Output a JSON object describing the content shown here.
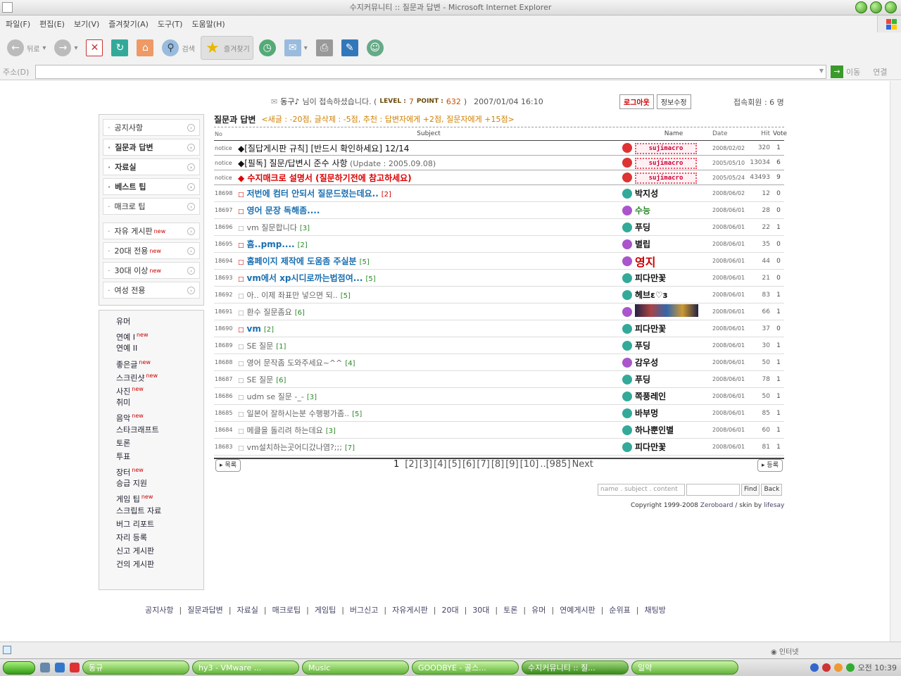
{
  "window": {
    "title": "수지커뮤니티 :: 질문과 답변 - Microsoft Internet Explorer"
  },
  "menu": [
    "파일(F)",
    "편집(E)",
    "보기(V)",
    "즐겨찾기(A)",
    "도구(T)",
    "도움말(H)"
  ],
  "toolbar": {
    "back": "뒤로",
    "search": "검색",
    "favorites": "즐겨찾기"
  },
  "address": {
    "label": "주소(D)",
    "value": "",
    "go": "이동",
    "links": "연결"
  },
  "login": {
    "user": "동구♪",
    "message": "님이 접속하셨습니다. (",
    "level_label": "LEVEL :",
    "level": "7",
    "point_label": "POINT :",
    "point": "632",
    "close": ")",
    "datetime": "2007/01/04 16:10",
    "logout": "로그아웃",
    "edit": "정보수정",
    "members": "접속회원 : 6 명"
  },
  "sidebar1": [
    {
      "label": "공지사항",
      "bold": false,
      "new": false
    },
    {
      "label": "질문과 답변",
      "bold": true,
      "new": false
    },
    {
      "label": "자료실",
      "bold": true,
      "new": false
    },
    {
      "label": "베스트 팁",
      "bold": true,
      "new": false
    },
    {
      "label": "매크로 팁",
      "bold": false,
      "new": false
    },
    {
      "label": "자유 게시판",
      "bold": false,
      "new": true
    },
    {
      "label": "20대 전용",
      "bold": false,
      "new": true
    },
    {
      "label": "30대 이상",
      "bold": false,
      "new": true
    },
    {
      "label": "여성 전용",
      "bold": false,
      "new": false
    }
  ],
  "new_label": "new",
  "sidebar2": [
    {
      "label": "유머",
      "new": false
    },
    {
      "label": "연예 I",
      "new": true
    },
    {
      "label": "연예 II",
      "new": false
    },
    {
      "label": "좋은글",
      "new": true
    },
    {
      "label": "스크린샷",
      "new": true
    },
    {
      "label": "사진",
      "new": true
    },
    {
      "label": "취미",
      "new": false
    },
    {
      "label": "음악",
      "new": true
    },
    {
      "label": "스타크래프트",
      "new": false
    },
    {
      "label": "토론",
      "new": false
    },
    {
      "label": "투표",
      "new": false
    },
    {
      "label": "장터",
      "new": true
    },
    {
      "label": "승급 지원",
      "new": false
    },
    {
      "label": "게임 팁",
      "new": true
    },
    {
      "label": "스크립트 자료",
      "new": false
    },
    {
      "label": "버그 리포트",
      "new": false
    },
    {
      "label": "자리 등록",
      "new": false
    },
    {
      "label": "신고 게시판",
      "new": false
    },
    {
      "label": "건의 게시판",
      "new": false
    }
  ],
  "board": {
    "title": "질문과 답변",
    "subtitle": "<새글 : -20점, 글삭제 : -5점, 추천 : 답변자에게 +2점, 질문자에게 +15점>",
    "headers": {
      "no": "No",
      "subject": "Subject",
      "name": "Name",
      "date": "Date",
      "hit": "Hit",
      "vote": "Vote"
    }
  },
  "notices": [
    {
      "no": "notice",
      "subject": "◆[질답게시판 규칙] [반드시 확인하세요] 12/14",
      "extra": "",
      "color": "#111",
      "bold": false,
      "name": "sujimacro",
      "date": "2008/02/02",
      "hit": "320",
      "vote": "1"
    },
    {
      "no": "notice",
      "subject": "◆[필독] 질문/답변시 준수 사항",
      "extra": " (Update : 2005.09.08)",
      "color": "#111",
      "bold": false,
      "name": "sujimacro",
      "date": "2005/05/10",
      "hit": "13034",
      "vote": "6"
    },
    {
      "no": "notice",
      "subject": "◆ 수지매크로 설명서 (질문하기전에 참고하세요)",
      "extra": "",
      "color": "#d00",
      "bold": true,
      "name": "sujimacro",
      "date": "2005/05/24",
      "hit": "43493",
      "vote": "9"
    }
  ],
  "posts": [
    {
      "no": "18698",
      "subject": "저번에 컴터 안되서 질문드렸는데요..",
      "comments": "[2]",
      "style": "bb",
      "cmred": true,
      "name": "박지성",
      "date": "2008/06/02",
      "hit": "12",
      "vote": "0"
    },
    {
      "no": "18697",
      "subject": "영어 문장 독해좀....",
      "comments": "",
      "style": "bb",
      "cmred": false,
      "name": "수능",
      "date": "2008/06/01",
      "hit": "28",
      "vote": "0"
    },
    {
      "no": "18696",
      "subject": "vm 질문합니다",
      "comments": "[3]",
      "style": "n",
      "cmred": false,
      "name": "푸딩",
      "date": "2008/06/01",
      "hit": "22",
      "vote": "1"
    },
    {
      "no": "18695",
      "subject": "흠..pmp....",
      "comments": "[2]",
      "style": "bb",
      "cmred": false,
      "name": "별립",
      "date": "2008/06/01",
      "hit": "35",
      "vote": "0"
    },
    {
      "no": "18694",
      "subject": "홈페이지 제작에 도움좀 주실분",
      "comments": "[5]",
      "style": "bb",
      "cmred": false,
      "name": "영지",
      "date": "2008/06/01",
      "hit": "44",
      "vote": "0"
    },
    {
      "no": "18693",
      "subject": "vm에서 xp시디로까는법점여...",
      "comments": "[5]",
      "style": "bb",
      "cmred": false,
      "name": "피다만꽃",
      "date": "2008/06/01",
      "hit": "21",
      "vote": "0"
    },
    {
      "no": "18692",
      "subject": "아.. 이제 좌표만 넣으면 되..",
      "comments": "[5]",
      "style": "n",
      "cmred": false,
      "name": "헤브ε♡з",
      "date": "2008/06/01",
      "hit": "83",
      "vote": "1"
    },
    {
      "no": "18691",
      "subject": "환수 질문좀요",
      "comments": "[6]",
      "style": "n",
      "cmred": false,
      "name": "",
      "date": "2008/06/01",
      "hit": "66",
      "vote": "1"
    },
    {
      "no": "18690",
      "subject": "vm",
      "comments": "[2]",
      "style": "bb",
      "cmred": false,
      "name": "피다만꽃",
      "date": "2008/06/01",
      "hit": "37",
      "vote": "0"
    },
    {
      "no": "18689",
      "subject": "SE 질문",
      "comments": "[1]",
      "style": "n",
      "cmred": false,
      "name": "푸딩",
      "date": "2008/06/01",
      "hit": "30",
      "vote": "1"
    },
    {
      "no": "18688",
      "subject": "영어 문작좀 도와주세요~^^",
      "comments": "[4]",
      "style": "n",
      "cmred": false,
      "name": "감우성",
      "date": "2008/06/01",
      "hit": "50",
      "vote": "1"
    },
    {
      "no": "18687",
      "subject": "SE 질문",
      "comments": "[6]",
      "style": "n",
      "cmred": false,
      "name": "푸딩",
      "date": "2008/06/01",
      "hit": "78",
      "vote": "1"
    },
    {
      "no": "18686",
      "subject": "udm se 질문 -_-",
      "comments": "[3]",
      "style": "n",
      "cmred": false,
      "name": "쪽풍레인",
      "date": "2008/06/01",
      "hit": "50",
      "vote": "1"
    },
    {
      "no": "18685",
      "subject": "일본어 잘하시는분 수행평가좀..",
      "comments": "[5]",
      "style": "n",
      "cmred": false,
      "name": "바부멍",
      "date": "2008/06/01",
      "hit": "85",
      "vote": "1"
    },
    {
      "no": "18684",
      "subject": "메클을 돌리려 하는데요",
      "comments": "[3]",
      "style": "n",
      "cmred": false,
      "name": "하나뿐인별",
      "date": "2008/06/01",
      "hit": "60",
      "vote": "1"
    },
    {
      "no": "18683",
      "subject": "vm설치하는곳어디갔나염?;;;",
      "comments": "[7]",
      "style": "n",
      "cmred": false,
      "name": "피다만꽃",
      "date": "2008/06/01",
      "hit": "81",
      "vote": "1"
    }
  ],
  "pager": {
    "list": "목록",
    "write": "등록",
    "pages": [
      "1",
      "[2]",
      "[3]",
      "[4]",
      "[5]",
      "[6]",
      "[7]",
      "[8]",
      "[9]",
      "[10]",
      "..[985]",
      "Next"
    ]
  },
  "search": {
    "placeholder": "name . subject . content",
    "find": "Find",
    "back": "Back"
  },
  "copyright": {
    "text": "Copyright 1999-2008",
    "zb": "Zeroboard",
    "sep": "/ skin by",
    "skin": "lifesay"
  },
  "footer": [
    "공지사항",
    "질문과답변",
    "자료실",
    "매크로팁",
    "게임팁",
    "버그신고",
    "자유게시판",
    "20대",
    "30대",
    "토론",
    "유머",
    "연예게시판",
    "순위표",
    "채팅방"
  ],
  "status": {
    "zone": "인터넷"
  },
  "taskbar": {
    "tasks": [
      "동규",
      "hy3 - VMware ...",
      "Music",
      "GOODBYE - 골스...",
      "수지커뮤니티 :: 질...",
      "일약"
    ],
    "clock": "오전 10:39"
  },
  "colors": {
    "accent": "#1a6fb0",
    "red": "#cc0000",
    "green": "#2a8a2a"
  }
}
